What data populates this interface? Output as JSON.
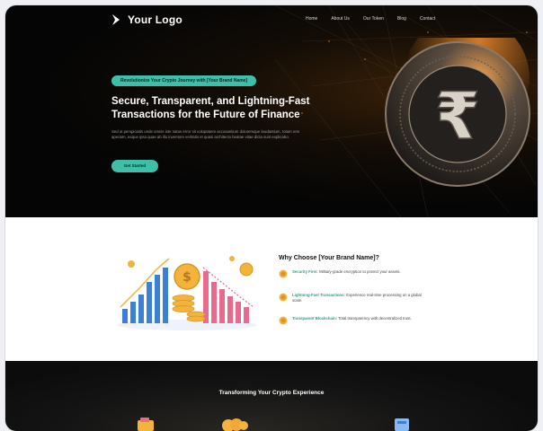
{
  "header": {
    "logo_text": "Your Logo",
    "nav": [
      "Home",
      "About Us",
      "Our Token",
      "Blog",
      "Contact"
    ]
  },
  "hero": {
    "badge": "Revolutionize Your Crypto Journey with [Your Brand Name]",
    "headline_line1": "Secure, Transparent, and Lightning-Fast",
    "headline_line2": "Transactions for the Future of Finance",
    "description": "Sed ut perspiciatis unde omnis iste natus error sit voluptatem accusantium doloremque laudantium, totam rem aperiam, eaque ipsa quae ab illo inventore veritatis et quasi architecto beatae vitae dicta sunt explicabo.",
    "cta_label": "Get Started",
    "coin_symbol": "₹"
  },
  "why": {
    "title": "Why Choose [Your Brand Name]?",
    "features": [
      {
        "title": "Security First:",
        "text": " Military-grade encryption to protect your assets."
      },
      {
        "title": "Lightning-Fast Transactions:",
        "text": " Experience real-time processing on a global scale."
      },
      {
        "title": "Transparent Blockchain:",
        "text": " Total transparency with decentralized trust."
      }
    ]
  },
  "transform": {
    "title": "Transforming Your Crypto Experience"
  },
  "colors": {
    "accent": "#3dbfa8",
    "hero_bg": "#050505",
    "coin_glow": "#e8862a",
    "chart_blue": "#3b7fd6",
    "chart_pink": "#e86a8c",
    "coin_gold": "#f2b43a"
  }
}
